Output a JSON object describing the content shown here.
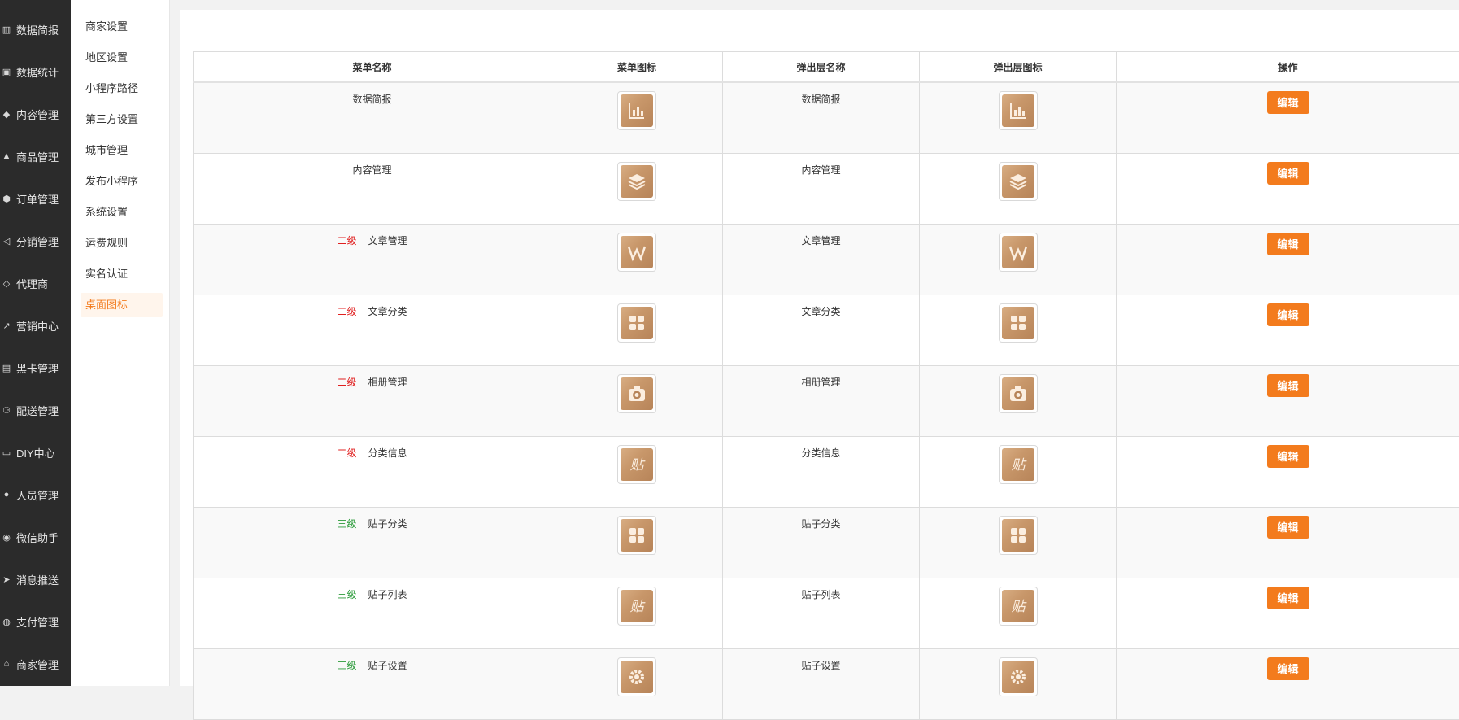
{
  "sidebar": {
    "items": [
      {
        "label": "数据简报",
        "icon": "bar-chart-icon"
      },
      {
        "label": "数据统计",
        "icon": "money-icon"
      },
      {
        "label": "内容管理",
        "icon": "tag-icon"
      },
      {
        "label": "商品管理",
        "icon": "bag-icon"
      },
      {
        "label": "订单管理",
        "icon": "cube-icon"
      },
      {
        "label": "分销管理",
        "icon": "share-icon"
      },
      {
        "label": "代理商",
        "icon": "diamond-icon"
      },
      {
        "label": "营销中心",
        "icon": "line-chart-icon"
      },
      {
        "label": "黑卡管理",
        "icon": "card-icon"
      },
      {
        "label": "配送管理",
        "icon": "motorbike-icon"
      },
      {
        "label": "DIY中心",
        "icon": "monitor-icon"
      },
      {
        "label": "人员管理",
        "icon": "users-icon"
      },
      {
        "label": "微信助手",
        "icon": "wechat-icon"
      },
      {
        "label": "消息推送",
        "icon": "send-icon"
      },
      {
        "label": "支付管理",
        "icon": "wechat-pay-icon"
      },
      {
        "label": "商家管理",
        "icon": "bank-icon"
      }
    ]
  },
  "subnav": {
    "items": [
      {
        "label": "商家设置"
      },
      {
        "label": "地区设置"
      },
      {
        "label": "小程序路径"
      },
      {
        "label": "第三方设置"
      },
      {
        "label": "城市管理"
      },
      {
        "label": "发布小程序"
      },
      {
        "label": "系统设置"
      },
      {
        "label": "运费规则"
      },
      {
        "label": "实名认证"
      },
      {
        "label": "桌面图标"
      }
    ],
    "active_index": 9
  },
  "table": {
    "headers": [
      "菜单名称",
      "菜单图标",
      "弹出层名称",
      "弹出层图标",
      "操作"
    ],
    "edit_label": "编辑",
    "rows": [
      {
        "level": "",
        "name": "数据简报",
        "icon": "bar-chart-icon",
        "popup_name": "数据简报"
      },
      {
        "level": "",
        "name": "内容管理",
        "icon": "layers-icon",
        "popup_name": "内容管理"
      },
      {
        "level": "二级",
        "name": "文章管理",
        "icon": "w-letter-icon",
        "popup_name": "文章管理"
      },
      {
        "level": "二级",
        "name": "文章分类",
        "icon": "grid-icon",
        "popup_name": "文章分类"
      },
      {
        "level": "二级",
        "name": "相册管理",
        "icon": "camera-icon",
        "popup_name": "相册管理"
      },
      {
        "level": "二级",
        "name": "分类信息",
        "icon": "tie-char-icon",
        "popup_name": "分类信息"
      },
      {
        "level": "三级",
        "name": "贴子分类",
        "icon": "grid-icon",
        "popup_name": "贴子分类"
      },
      {
        "level": "三级",
        "name": "贴子列表",
        "icon": "tie-char-icon",
        "popup_name": "贴子列表"
      },
      {
        "level": "三级",
        "name": "贴子设置",
        "icon": "gear-icon",
        "popup_name": "贴子设置"
      }
    ]
  },
  "colors": {
    "accent": "#f37b1d",
    "level2": "#e02020",
    "level3": "#2b9b3a",
    "sidebar_bg": "#2b2b2b"
  }
}
